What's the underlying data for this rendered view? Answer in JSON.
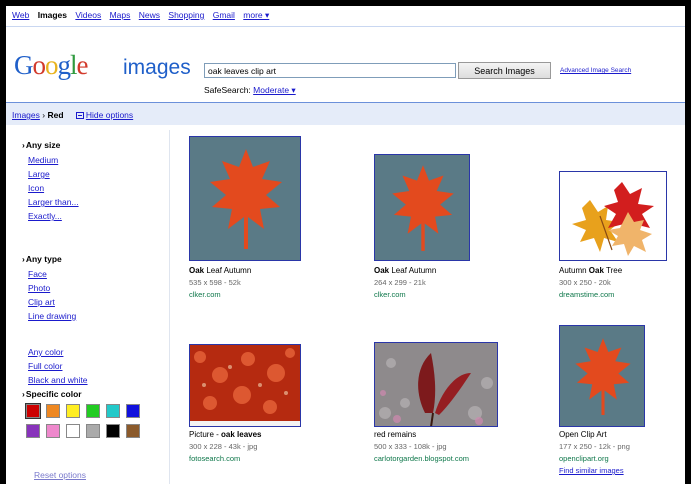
{
  "topnav": [
    "Web",
    "Images",
    "Videos",
    "Maps",
    "News",
    "Shopping",
    "Gmail",
    "more ▾"
  ],
  "topnav_selected": "Images",
  "logo": {
    "google": "Google",
    "sub": "images"
  },
  "search": {
    "value": "oak leaves clip art",
    "button": "Search Images",
    "advanced": "Advanced Image Search"
  },
  "safesearch": {
    "label": "SafeSearch:",
    "value": "Moderate ▾"
  },
  "breadcrumb": {
    "images": "Images",
    "sep": "›",
    "current": "Red",
    "hide": "Hide options"
  },
  "sidebar": {
    "size_title": "Any size",
    "sizes": [
      "Medium",
      "Large",
      "Icon",
      "Larger than...",
      "Exactly..."
    ],
    "type_title": "Any type",
    "types": [
      "Face",
      "Photo",
      "Clip art",
      "Line drawing"
    ],
    "colors": [
      "Any color",
      "Full color",
      "Black and white"
    ],
    "specific_title": "Specific color",
    "swatches": [
      "#cc0000",
      "#ee8822",
      "#ffee22",
      "#22cc22",
      "#22c9c9",
      "#1111dd",
      "#8833bb",
      "#ee88cc",
      "#ffffff",
      "#aaaaaa",
      "#000000",
      "#8b5a2b"
    ],
    "reset": "Reset options"
  },
  "results": [
    {
      "cap_pre": "",
      "cap_bold": "Oak",
      "cap_post": " Leaf Autumn",
      "meta": "535 x 598 - 52k",
      "src": "clker.com"
    },
    {
      "cap_pre": "",
      "cap_bold": "Oak",
      "cap_post": " Leaf Autumn",
      "meta": "264 x 299 - 21k",
      "src": "clker.com"
    },
    {
      "cap_pre": "Autumn ",
      "cap_bold": "Oak",
      "cap_post": " Tree",
      "meta": "300 x 250 - 20k",
      "src": "dreamstime.com"
    },
    {
      "cap_pre": "Picture - ",
      "cap_bold": "oak leaves",
      "cap_post": "",
      "meta": "300 x 228 - 43k - jpg",
      "src": "fotosearch.com"
    },
    {
      "cap_pre": "red remains",
      "cap_bold": "",
      "cap_post": "",
      "meta": "500 x 333 - 108k - jpg",
      "src": "carlotorgarden.blogspot.com"
    },
    {
      "cap_pre": "Open Clip Art",
      "cap_bold": "",
      "cap_post": "",
      "meta": "177 x 250 - 12k - png",
      "src": "openclipart.org",
      "similar": "Find similar images"
    }
  ],
  "colors": {
    "link": "#1a1acc",
    "source": "#0e774a",
    "bar": "#e5ecf9",
    "thumb_bg": "#5a7a86",
    "leaf": "#e34a1e"
  }
}
